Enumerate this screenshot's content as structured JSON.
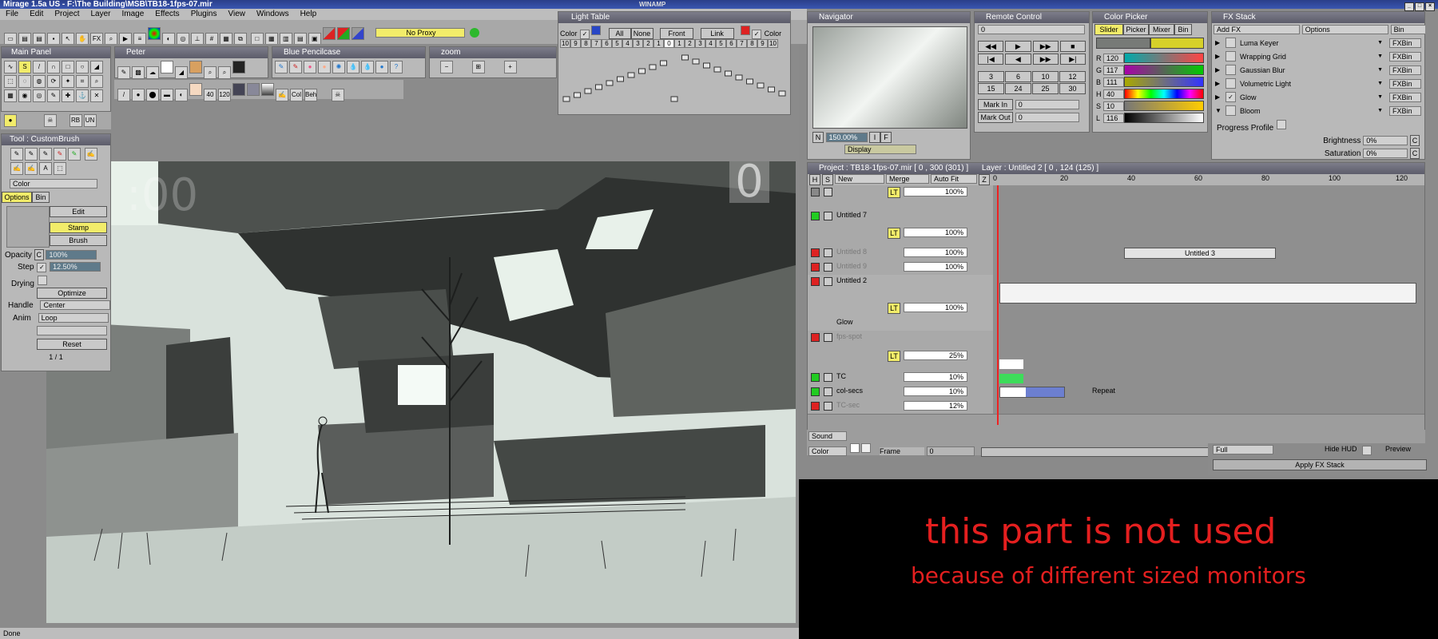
{
  "app": {
    "title": "Mirage 1.5a US - F:\\The Building\\MSB\\TB18-1fps-07.mir",
    "winamp": "WINAMP",
    "status": "Done"
  },
  "menu": [
    "File",
    "Edit",
    "Project",
    "Layer",
    "Image",
    "Effects",
    "Plugins",
    "View",
    "Windows",
    "Help"
  ],
  "toolbar": {
    "proxy": "No Proxy"
  },
  "panels": {
    "main_panel": "Main Panel",
    "peter": "Peter",
    "blue_pencil": "Blue Pencilcase",
    "zoom": "zoom",
    "light_table": "Light Table",
    "navigator": "Navigator",
    "remote": "Remote Control",
    "color_picker": "Color Picker",
    "fx_stack": "FX Stack",
    "tool": "Tool : CustomBrush"
  },
  "light_table": {
    "color_label": "Color",
    "buttons": [
      "All",
      "None",
      "Front",
      "Link"
    ],
    "color_label2": "Color",
    "numbers": [
      "10",
      "9",
      "8",
      "7",
      "6",
      "5",
      "4",
      "3",
      "2",
      "1",
      "0",
      "1",
      "2",
      "3",
      "4",
      "5",
      "6",
      "7",
      "8",
      "9",
      "10"
    ]
  },
  "navigator": {
    "zoom": "150.00%",
    "display": "Display",
    "letters": [
      "N",
      "I",
      "F"
    ]
  },
  "remote": {
    "counter": "0",
    "nums": [
      "3",
      "6",
      "10",
      "12",
      "15",
      "24",
      "25",
      "30"
    ],
    "mark_in": "Mark In",
    "mark_out": "Mark Out",
    "mark_in_val": "0",
    "mark_out_val": "0"
  },
  "color_picker": {
    "tabs": [
      "Slider",
      "Picker",
      "Mixer",
      "Bin"
    ],
    "channels": [
      {
        "label": "R",
        "value": "120"
      },
      {
        "label": "G",
        "value": "117"
      },
      {
        "label": "B",
        "value": "111"
      },
      {
        "label": "H",
        "value": "40"
      },
      {
        "label": "S",
        "value": "10"
      },
      {
        "label": "L",
        "value": "116"
      }
    ]
  },
  "fx_stack": {
    "add_fx": "Add FX",
    "options": "Options",
    "bin": "Bin",
    "items": [
      {
        "name": "Luma Keyer",
        "bin": "FXBin"
      },
      {
        "name": "Wrapping Grid",
        "bin": "FXBin"
      },
      {
        "name": "Gaussian Blur",
        "bin": "FXBin"
      },
      {
        "name": "Volumetric Light",
        "bin": "FXBin"
      },
      {
        "name": "Glow",
        "bin": "FXBin"
      },
      {
        "name": "Bloom",
        "bin": "FXBin"
      }
    ],
    "progress_profile": "Progress Profile",
    "brightness": "Brightness",
    "brightness_val": "0%",
    "saturation": "Saturation",
    "saturation_val": "0%",
    "mode": "Full",
    "hide_hud": "Hide HUD",
    "preview": "Preview",
    "apply": "Apply FX Stack"
  },
  "project": {
    "title": "Project : TB18-1fps-07.mir [ 0 , 300  (301) ]",
    "layer": "Layer : Untitled 2 [ 0 , 124  (125) ]",
    "header": {
      "h": "H",
      "s": "S",
      "new": "New",
      "merge": "Merge",
      "autofit": "Auto Fit",
      "z": "Z"
    },
    "ruler": [
      "0",
      "20",
      "40",
      "60",
      "80",
      "100",
      "120"
    ],
    "layers": [
      {
        "name": "",
        "opacity": "100%",
        "tag": "LT"
      },
      {
        "name": "Untitled 7",
        "opacity": "100%",
        "tag": "LT"
      },
      {
        "name": "Untitled 8",
        "opacity": "100%",
        "tag": ""
      },
      {
        "name": "Untitled 9",
        "opacity": "100%",
        "tag": ""
      },
      {
        "name": "Untitled 2",
        "opacity": "100%",
        "tag": "LT",
        "fx": "Glow"
      },
      {
        "name": "fps-spot",
        "opacity": "25%",
        "tag": "LT"
      },
      {
        "name": "TC",
        "opacity": "10%",
        "tag": ""
      },
      {
        "name": "col-secs",
        "opacity": "10%",
        "tag": ""
      },
      {
        "name": "TC-sec",
        "opacity": "12%",
        "tag": ""
      }
    ],
    "clip_untitled3": "Untitled 3",
    "repeat": "Repeat",
    "sound": "Sound",
    "color": "Color",
    "frame": "Frame",
    "frame_val": "0",
    "clip_labels": [
      "0",
      "0",
      "0"
    ]
  },
  "tool_panel": {
    "tabs": [
      "Options",
      "Bin"
    ],
    "color": "Color",
    "edit": "Edit",
    "stamp": "Stamp",
    "brush": "Brush",
    "opacity": "Opacity",
    "opacity_val": "100%",
    "opacity_c": "C",
    "step": "Step",
    "step_val": "12.50%",
    "drying": "Drying",
    "optimize": "Optimize",
    "handle": "Handle",
    "handle_val": "Center",
    "anim": "Anim",
    "anim_val": "Loop",
    "reset": "Reset",
    "page": "1 / 1"
  },
  "canvas": {
    "hud_left": ":00",
    "hud_right": "0"
  },
  "notice": {
    "line1": "this part is not used",
    "line2": "because of different sized monitors"
  },
  "colors": {
    "title_blue": "#2a3f8a",
    "panel_grey": "#b9b9b9",
    "accent_red": "#e41f1f",
    "paper": "#e8f1ea"
  }
}
